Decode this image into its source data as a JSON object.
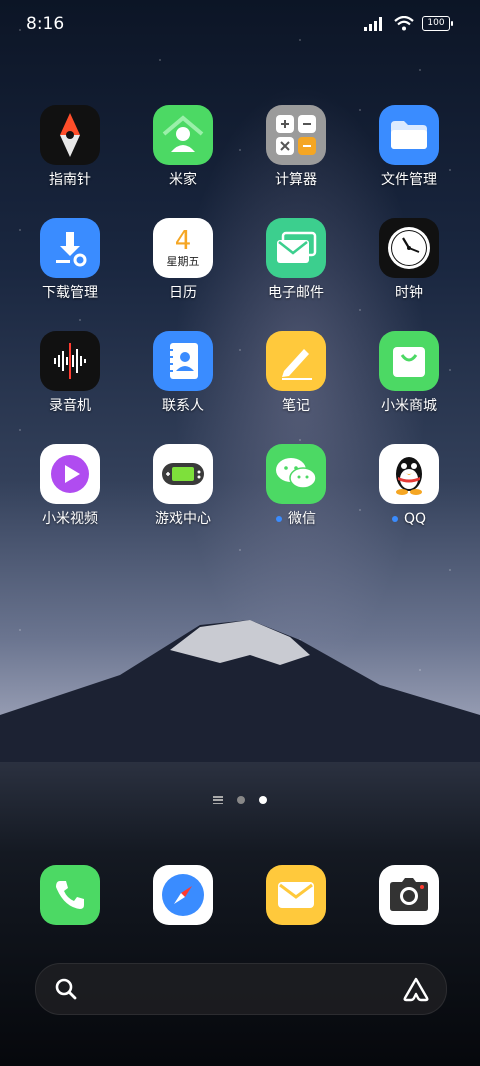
{
  "status_bar": {
    "time": "8:16",
    "battery": "100"
  },
  "apps": [
    {
      "id": "compass",
      "label": "指南针"
    },
    {
      "id": "mijia",
      "label": "米家"
    },
    {
      "id": "calculator",
      "label": "计算器"
    },
    {
      "id": "file-manager",
      "label": "文件管理"
    },
    {
      "id": "downloads",
      "label": "下载管理"
    },
    {
      "id": "calendar",
      "label": "日历",
      "day": "4",
      "weekday": "星期五"
    },
    {
      "id": "email",
      "label": "电子邮件"
    },
    {
      "id": "clock",
      "label": "时钟"
    },
    {
      "id": "recorder",
      "label": "录音机"
    },
    {
      "id": "contacts",
      "label": "联系人"
    },
    {
      "id": "notes",
      "label": "笔记"
    },
    {
      "id": "mi-store",
      "label": "小米商城"
    },
    {
      "id": "mi-video",
      "label": "小米视频"
    },
    {
      "id": "game-center",
      "label": "游戏中心"
    },
    {
      "id": "wechat",
      "label": "微信",
      "new_badge": true
    },
    {
      "id": "qq",
      "label": "QQ",
      "new_badge": true
    }
  ],
  "dock": [
    {
      "id": "phone",
      "icon": "phone-icon"
    },
    {
      "id": "browser",
      "icon": "compass-safari-icon"
    },
    {
      "id": "messages",
      "icon": "envelope-icon"
    },
    {
      "id": "camera",
      "icon": "camera-icon"
    }
  ],
  "pager": {
    "pages": 2,
    "active": 2
  },
  "colors": {
    "green": "#4cd964",
    "blue": "#3a8cff",
    "yellow": "#ffc93c",
    "teal": "#3ccf8e"
  }
}
